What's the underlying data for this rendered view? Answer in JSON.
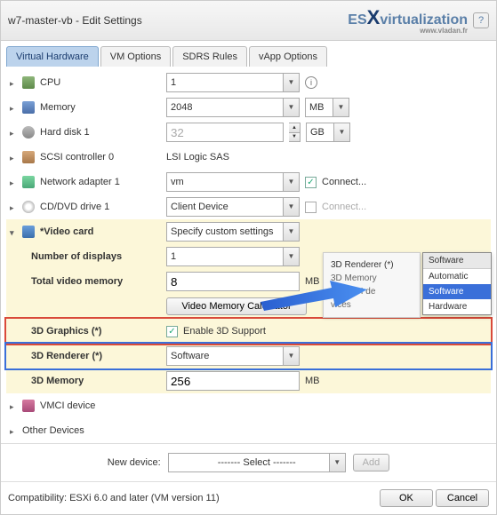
{
  "title": "w7-master-vb - Edit Settings",
  "logo": {
    "text": "ES",
    "x": "X",
    "rest": "virtualization",
    "sub": "www.vladan.fr"
  },
  "tabs": [
    "Virtual Hardware",
    "VM Options",
    "SDRS Rules",
    "vApp Options"
  ],
  "rows": {
    "cpu": {
      "label": "CPU",
      "value": "1"
    },
    "memory": {
      "label": "Memory",
      "value": "2048",
      "unit": "MB"
    },
    "hdd": {
      "label": "Hard disk 1",
      "value": "32",
      "unit": "GB"
    },
    "scsi": {
      "label": "SCSI controller 0",
      "value": "LSI Logic SAS"
    },
    "net": {
      "label": "Network adapter 1",
      "value": "vm",
      "connect": "Connect..."
    },
    "cd": {
      "label": "CD/DVD drive 1",
      "value": "Client Device",
      "connect": "Connect..."
    },
    "video": {
      "label": "*Video card",
      "value": "Specify custom settings"
    },
    "numdisp": {
      "label": "Number of displays",
      "value": "1"
    },
    "totmem": {
      "label": "Total video memory",
      "value": "8",
      "unit": "MB"
    },
    "calc": "Video Memory Calculator",
    "gfx3d": {
      "label": "3D Graphics (*)",
      "chk": "Enable 3D Support"
    },
    "renderer": {
      "label": "3D Renderer (*)",
      "value": "Software"
    },
    "mem3d": {
      "label": "3D Memory",
      "value": "256",
      "unit": "MB"
    },
    "vmci": "VMCI device",
    "other": "Other Devices"
  },
  "callout": {
    "tooltip": {
      "title": "3D Renderer (*)",
      "l1": "3D Memory",
      "l2": "VMCI de",
      "l3": "vices"
    },
    "menu": {
      "header": "Software",
      "items": [
        "Automatic",
        "Software",
        "Hardware"
      ],
      "selected": "Software"
    }
  },
  "footer": {
    "newdev": "New device:",
    "select": "------- Select -------",
    "add": "Add",
    "compat": "Compatibility: ESXi 6.0 and later (VM version 11)",
    "ok": "OK",
    "cancel": "Cancel"
  }
}
